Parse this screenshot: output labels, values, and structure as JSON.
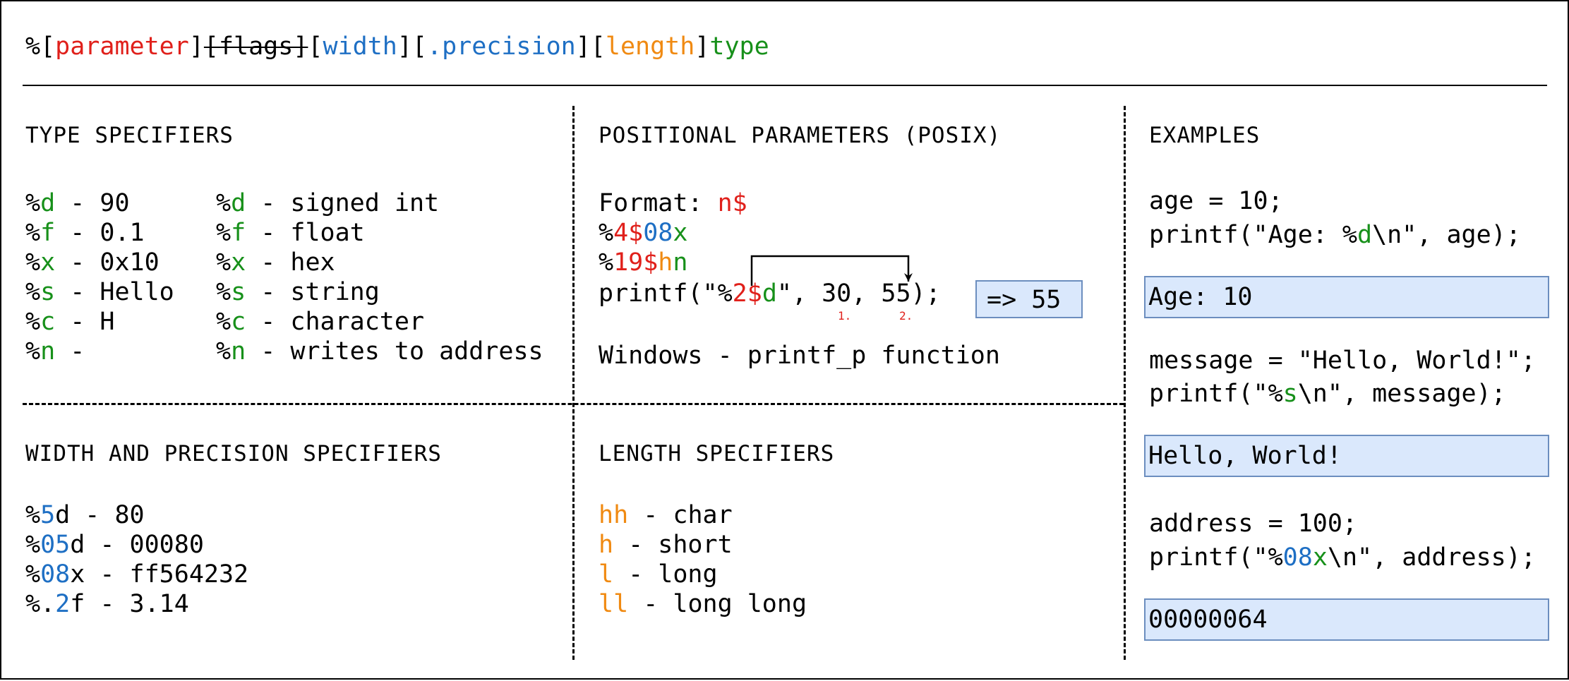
{
  "syntax": {
    "open1": "%[",
    "parameter": "parameter",
    "close1": "]",
    "flags": "[flags]",
    "open2": "[",
    "width": "width",
    "close2": "][",
    "precision": ".precision",
    "close3": "][",
    "length": "length",
    "close4": "]",
    "type": "type"
  },
  "type_specifiers": {
    "title": "TYPE SPECIFIERS",
    "rows": [
      {
        "pct": "%",
        "code": "d",
        "example": " - 90",
        "desc": " - signed int"
      },
      {
        "pct": "%",
        "code": "f",
        "example": " - 0.1",
        "desc": " - float"
      },
      {
        "pct": "%",
        "code": "x",
        "example": " - 0x10",
        "desc": " - hex"
      },
      {
        "pct": "%",
        "code": "s",
        "example": " - Hello",
        "desc": " - string"
      },
      {
        "pct": "%",
        "code": "c",
        "example": " - H",
        "desc": " - character"
      },
      {
        "pct": "%",
        "code": "n",
        "example": " -",
        "desc": " - writes to address"
      }
    ]
  },
  "positional": {
    "title": "POSITIONAL PARAMETERS (POSIX)",
    "format_label": "Format: ",
    "format_value": "n$",
    "ex1": {
      "pct": "%",
      "pos": "4$",
      "width": "08",
      "type": "x"
    },
    "ex2": {
      "pct": "%",
      "pos": "19$",
      "len": "h",
      "type": "n"
    },
    "printf": {
      "pre": "printf(\"%",
      "pos": "2$",
      "type": "d",
      "post": "\", 30, 55);"
    },
    "result": "=> 55",
    "marker1": "1.",
    "marker2": "2.",
    "windows": "Windows - printf_p function"
  },
  "width_precision": {
    "title": "WIDTH AND PRECISION SPECIFIERS",
    "rows": [
      {
        "pre": "%",
        "num": "5",
        "post": "d - ",
        "value": "   80"
      },
      {
        "pre": "%",
        "num": "05",
        "post": "d - ",
        "value": "00080"
      },
      {
        "pre": "%",
        "num": "08",
        "post": "x - ",
        "value": "ff564232"
      },
      {
        "pre": "%.",
        "num": "2",
        "post": "f - ",
        "value": "3.14"
      }
    ]
  },
  "length": {
    "title": "LENGTH SPECIFIERS",
    "rows": [
      {
        "spec": "hh",
        "desc": " - char"
      },
      {
        "spec": "h",
        "desc": " - short"
      },
      {
        "spec": "l",
        "desc": " - long"
      },
      {
        "spec": "ll",
        "desc": " - long long"
      }
    ]
  },
  "examples": {
    "title": "EXAMPLES",
    "ex1": {
      "assign": "age = 10;",
      "pre": "printf(\"Age: %",
      "type": "d",
      "post": "\\n\", age);",
      "output": "Age: 10"
    },
    "ex2": {
      "assign": "message = \"Hello, World!\";",
      "pre": "printf(\"%",
      "type": "s",
      "post": "\\n\", message);",
      "output": "Hello, World!"
    },
    "ex3": {
      "assign": "address = 100;",
      "pre": "printf(\"%",
      "width": "08",
      "type": "x",
      "post": "\\n\", address);",
      "output": "00000064"
    }
  },
  "colors": {
    "parameter": "#e0201b",
    "type": "#17901a",
    "width": "#1e6fc4",
    "length": "#f08a12",
    "result_fill": "#dae8fc",
    "result_border": "#6c8ebf"
  }
}
